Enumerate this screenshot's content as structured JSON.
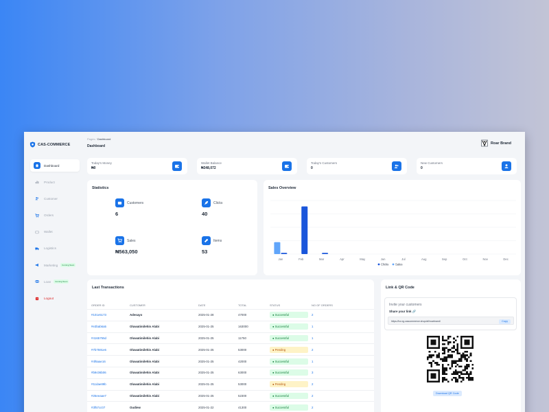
{
  "app": {
    "brand": "CAS-COMMERCE",
    "user_name": "Roar Brand"
  },
  "breadcrumb": {
    "parent": "Pages",
    "separator": "/",
    "current": "Dashboard"
  },
  "page_title": "Dashboard",
  "sidebar": {
    "items": [
      {
        "label": "Dashboard",
        "icon": "home-icon",
        "active": true
      },
      {
        "label": "Product",
        "icon": "bar-chart-icon"
      },
      {
        "label": "Customer",
        "icon": "users-icon"
      },
      {
        "label": "Orders",
        "icon": "cart-icon"
      },
      {
        "label": "Wallet",
        "icon": "wallet-icon"
      },
      {
        "label": "Logistics",
        "icon": "truck-icon"
      },
      {
        "label": "Marketing",
        "icon": "megaphone-icon",
        "badge": "Coming Soon"
      },
      {
        "label": "Loan",
        "icon": "loan-icon",
        "badge": "Coming Soon"
      },
      {
        "label": "Logout",
        "icon": "logout-icon"
      }
    ]
  },
  "stats": [
    {
      "label": "Today's Money",
      "value": "₦0",
      "icon": "wallet-icon"
    },
    {
      "label": "Wallet Balance",
      "value": "₦348,072",
      "icon": "wallet-icon"
    },
    {
      "label": "Today's Customers",
      "value": "0",
      "icon": "users-icon"
    },
    {
      "label": "New Customers",
      "value": "0",
      "icon": "user-icon"
    }
  ],
  "statistics": {
    "title": "Statistics",
    "items": [
      {
        "label": "Customers",
        "value": "6",
        "icon": "wallet-icon"
      },
      {
        "label": "Clicks",
        "value": "40",
        "icon": "rocket-icon"
      },
      {
        "label": "Sales",
        "value": "₦563,050",
        "icon": "cart-icon"
      },
      {
        "label": "Items",
        "value": "53",
        "icon": "wrench-icon"
      }
    ]
  },
  "sales_overview": {
    "title": "Sales Overview"
  },
  "chart_data": {
    "type": "bar",
    "categories": [
      "Jan",
      "Feb",
      "Mar",
      "Apr",
      "May",
      "Jun",
      "Jul",
      "Aug",
      "Sep",
      "Oct",
      "Nov",
      "Dec"
    ],
    "series": [
      {
        "name": "Clicks",
        "color": "#1a56db",
        "values": [
          1,
          40,
          1,
          0,
          0,
          0,
          0,
          0,
          0,
          0,
          0,
          0
        ]
      },
      {
        "name": "Sales",
        "color": "#60a5fa",
        "values": [
          10,
          0,
          0,
          0,
          0,
          0,
          0,
          0,
          0,
          0,
          0,
          0
        ]
      }
    ],
    "ylim": [
      0,
      45
    ],
    "grid": true,
    "legend": "bottom-center"
  },
  "transactions": {
    "title": "Last Transactions",
    "columns": [
      "ORDER ID",
      "CUSTOMER",
      "DATE",
      "TOTAL",
      "STATUS",
      "NO OF ORDERS"
    ],
    "rows": [
      {
        "id": "#101e5173",
        "customer": "Adesayo",
        "date": "2025-01-28",
        "total": "47000",
        "status": "Successful",
        "count": "2"
      },
      {
        "id": "#e3bab6a5",
        "customer": "Oluwatimilehin Alabi",
        "date": "2025-01-25",
        "total": "163000",
        "status": "Successful",
        "count": "1"
      },
      {
        "id": "#4165755d",
        "customer": "Oluwatimilehin Alabi",
        "date": "2025-01-25",
        "total": "11750",
        "status": "Successful",
        "count": "1"
      },
      {
        "id": "#7b7591e6",
        "customer": "Oluwatimilehin Alabi",
        "date": "2025-01-25",
        "total": "53000",
        "status": "Pending",
        "count": "2"
      },
      {
        "id": "#4f6aae16",
        "customer": "Oluwatimilehin Alabi",
        "date": "2025-01-25",
        "total": "42000",
        "status": "Successful",
        "count": "1"
      },
      {
        "id": "#b9c06b06",
        "customer": "Oluwatimilehin Alabi",
        "date": "2025-01-25",
        "total": "63000",
        "status": "Successful",
        "count": "3"
      },
      {
        "id": "#11dae89b",
        "customer": "Oluwatimilehin Alabi",
        "date": "2025-01-25",
        "total": "53000",
        "status": "Pending",
        "count": "2"
      },
      {
        "id": "#25eeaae7",
        "customer": "Oluwatimilehin Alabi",
        "date": "2025-01-25",
        "total": "52300",
        "status": "Successful",
        "count": "2"
      },
      {
        "id": "#3f57cc07",
        "customer": "Oudiew",
        "date": "2025-01-22",
        "total": "41300",
        "status": "Successful",
        "count": "2"
      }
    ]
  },
  "link_qr": {
    "title": "Link & QR Code",
    "invite_title": "Invite your customers",
    "share_label": "Share your link",
    "link_url": "https://bz.ng.cascommerce.shop/all/roarbrand/",
    "copy_label": "Copy",
    "download_label": "Download QR Code"
  },
  "colors": {
    "accent": "#1a73e8",
    "success": "#15803d",
    "pending": "#b45309"
  }
}
